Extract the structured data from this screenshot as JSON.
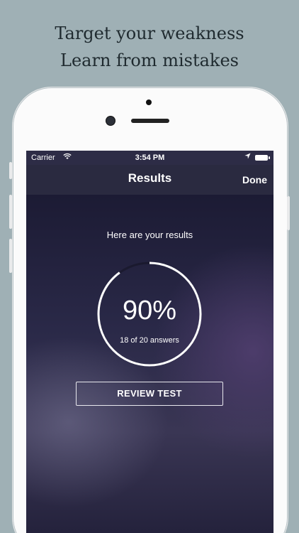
{
  "marketing": {
    "line1": "Target your weakness",
    "line2": "Learn from mistakes"
  },
  "status_bar": {
    "carrier": "Carrier",
    "time": "3:54 PM"
  },
  "nav": {
    "title": "Results",
    "done_label": "Done"
  },
  "results": {
    "intro": "Here are your results",
    "percent": "90%",
    "answers_text": "18 of 20 answers",
    "progress_fraction": 0.9
  },
  "actions": {
    "review_label": "REVIEW TEST"
  },
  "colors": {
    "background": "#9fb0b5",
    "phone_body": "#fbfbfb",
    "screen_dark": "#2a2a40",
    "ring": "#ffffff"
  },
  "icons": {
    "wifi": "wifi-icon",
    "location": "location-arrow-icon",
    "battery": "battery-icon"
  }
}
